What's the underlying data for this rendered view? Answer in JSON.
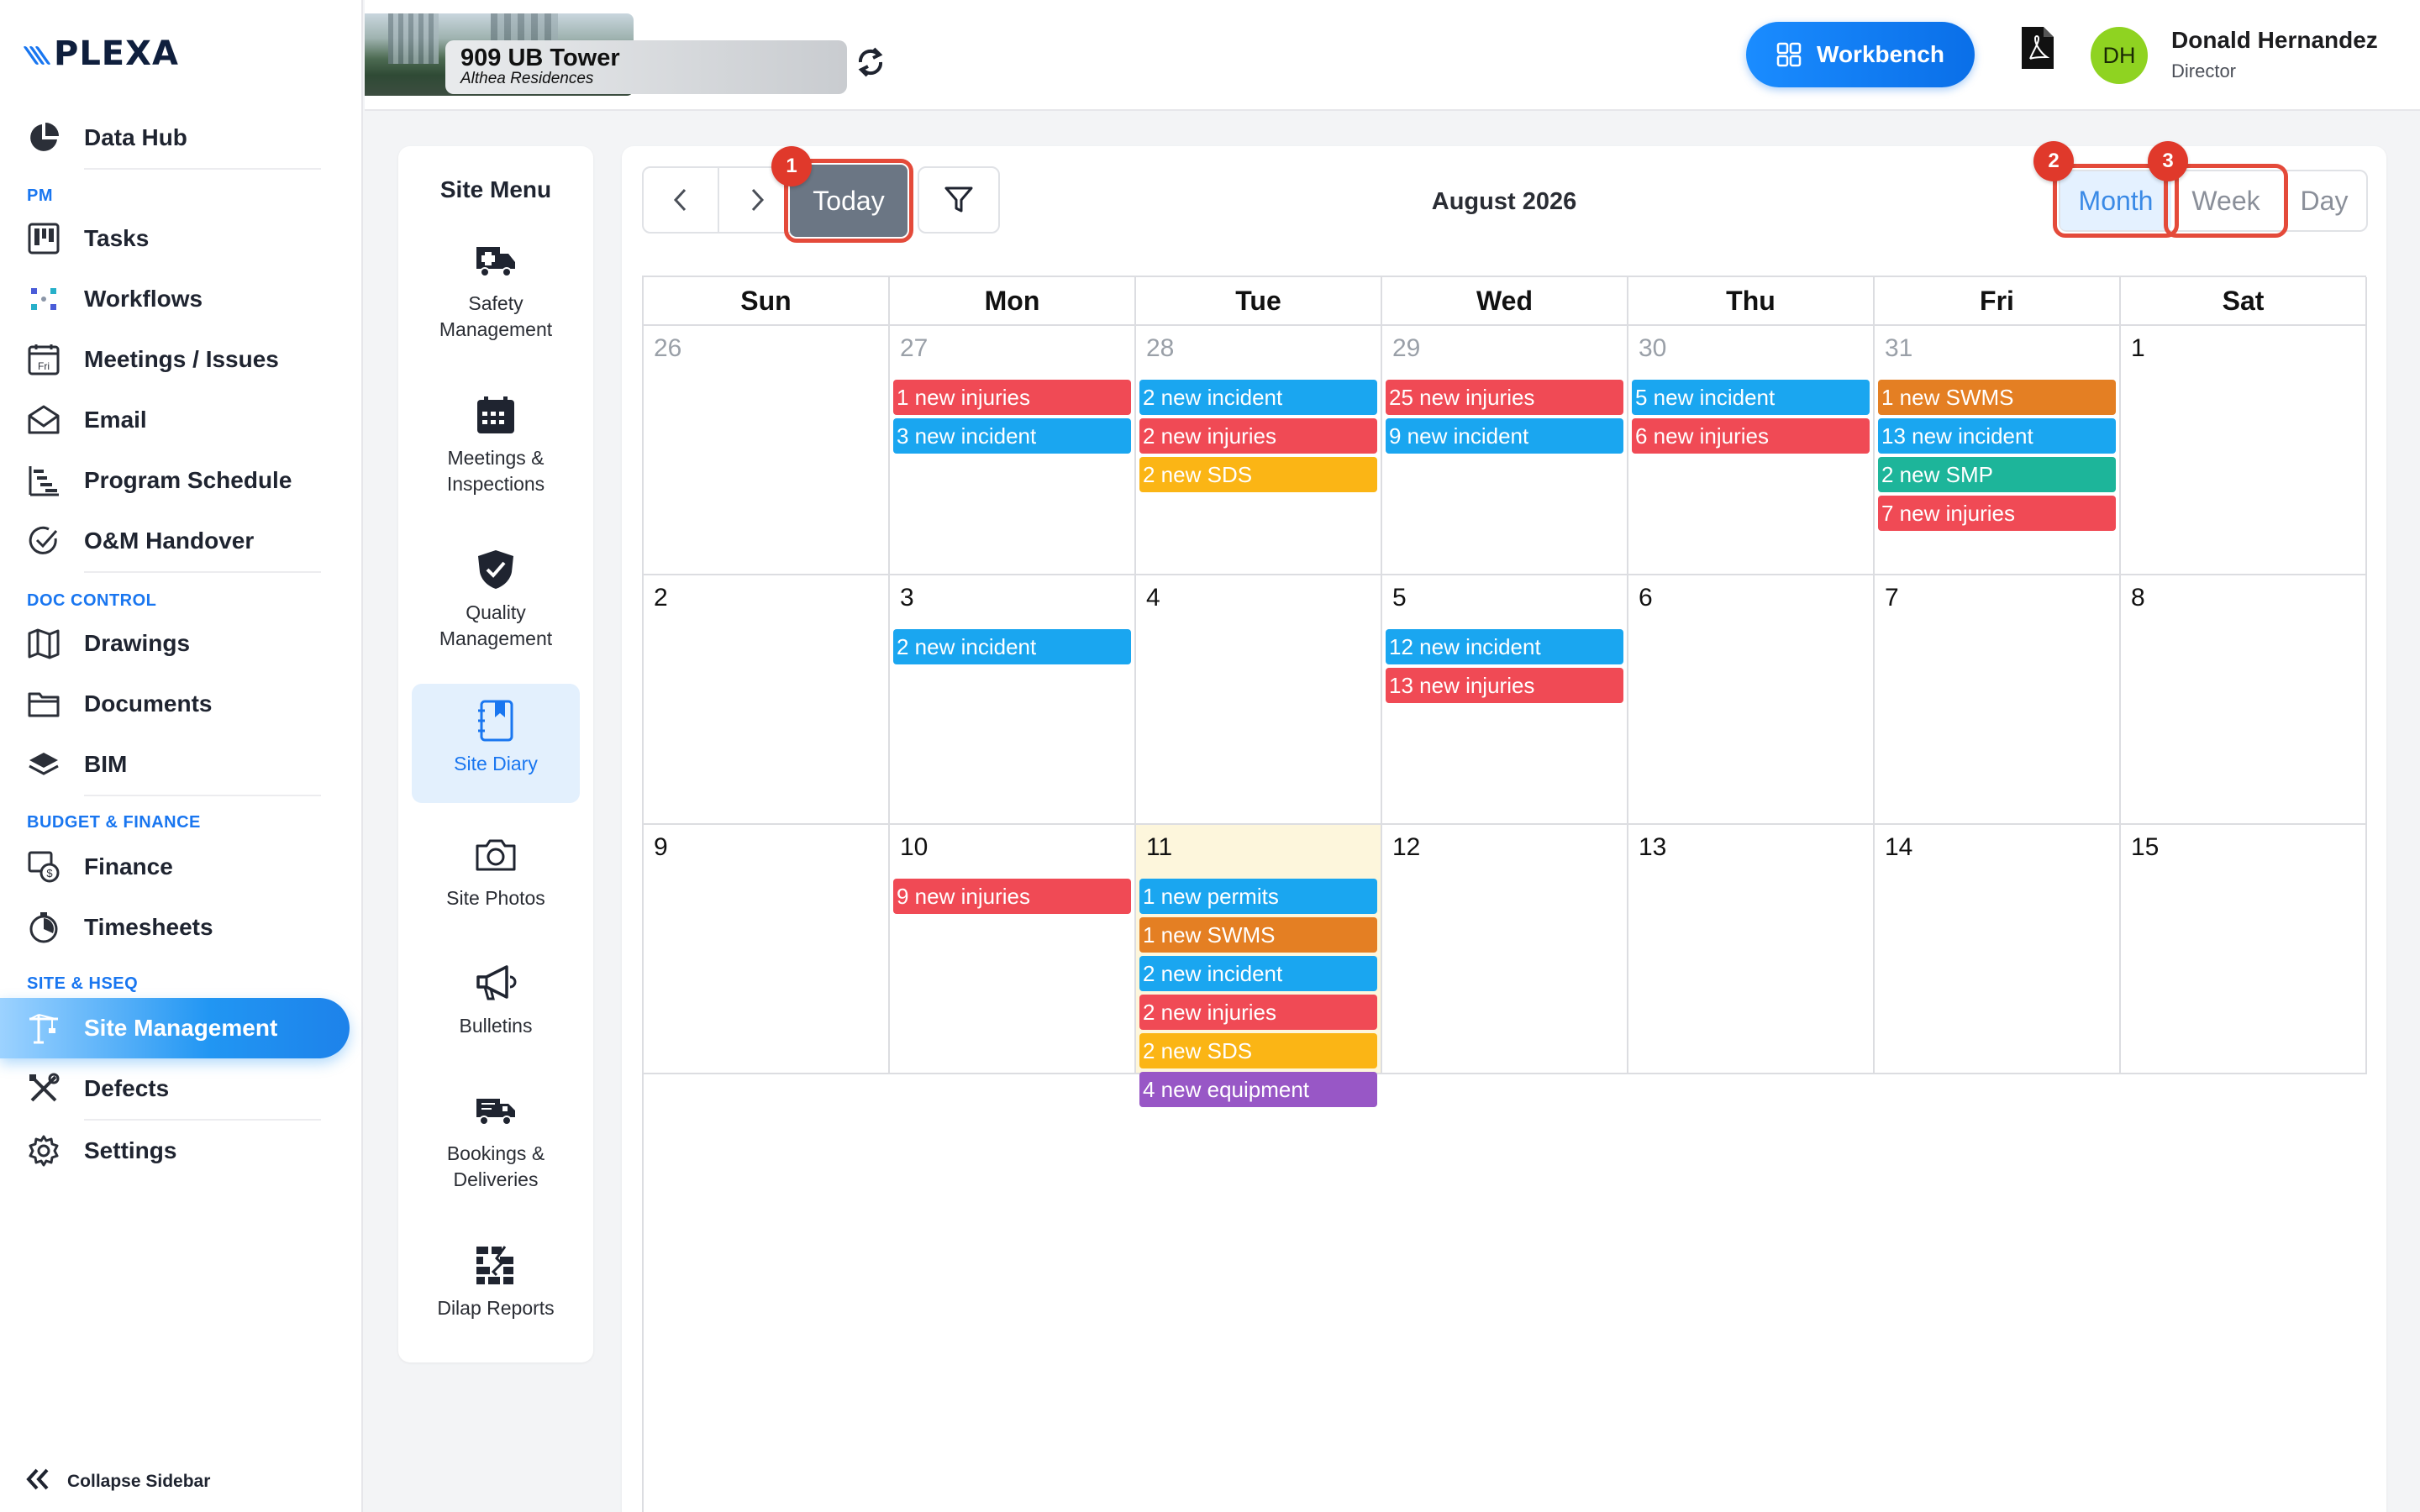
{
  "brand": {
    "name": "PLEXA"
  },
  "sidebar": {
    "items": [
      {
        "label": "Data Hub",
        "icon": "pie-chart-icon"
      },
      {
        "label": "Tasks",
        "icon": "kanban-icon"
      },
      {
        "label": "Workflows",
        "icon": "workflow-icon"
      },
      {
        "label": "Meetings / Issues",
        "icon": "calendar-day-icon"
      },
      {
        "label": "Email",
        "icon": "envelope-icon"
      },
      {
        "label": "Program Schedule",
        "icon": "gantt-icon"
      },
      {
        "label": "O&M Handover",
        "icon": "check-circle-icon"
      },
      {
        "label": "Drawings",
        "icon": "map-icon"
      },
      {
        "label": "Documents",
        "icon": "folder-icon"
      },
      {
        "label": "BIM",
        "icon": "layers-icon"
      },
      {
        "label": "Finance",
        "icon": "finance-icon"
      },
      {
        "label": "Timesheets",
        "icon": "stopwatch-icon"
      },
      {
        "label": "Site Management",
        "icon": "crane-icon"
      },
      {
        "label": "Defects",
        "icon": "tools-icon"
      },
      {
        "label": "Settings",
        "icon": "gear-icon"
      }
    ],
    "sections": {
      "pm": "PM",
      "doc": "DOC CONTROL",
      "budget": "BUDGET & FINANCE",
      "site": "SITE & HSEQ"
    },
    "active": "Site Management",
    "collapse_label": "Collapse Sidebar",
    "calendar_icon_text": "Fri"
  },
  "header": {
    "project_name": "909 UB Tower",
    "project_sub": "Althea Residences",
    "workbench_label": "Workbench",
    "user": {
      "initials": "DH",
      "name": "Donald Hernandez",
      "role": "Director"
    }
  },
  "site_menu": {
    "title": "Site Menu",
    "items": [
      {
        "label1": "Safety",
        "label2": "Management",
        "icon": "ambulance-icon"
      },
      {
        "label1": "Meetings &",
        "label2": "Inspections",
        "icon": "calendar-icon"
      },
      {
        "label1": "Quality",
        "label2": "Management",
        "icon": "shield-check-icon"
      },
      {
        "label1": "Site Diary",
        "label2": "",
        "icon": "diary-icon"
      },
      {
        "label1": "Site Photos",
        "label2": "",
        "icon": "camera-icon"
      },
      {
        "label1": "Bulletins",
        "label2": "",
        "icon": "megaphone-icon"
      },
      {
        "label1": "Bookings &",
        "label2": "Deliveries",
        "icon": "truck-icon"
      },
      {
        "label1": "Dilap Reports",
        "label2": "",
        "icon": "broken-wall-icon"
      }
    ],
    "active": "Site Diary"
  },
  "calendar": {
    "title": "August 2026",
    "today_label": "Today",
    "views": {
      "month": "Month",
      "week": "Week",
      "day": "Day"
    },
    "active_view": "Month",
    "badges": [
      "1",
      "2",
      "3"
    ],
    "weekdays": [
      "Sun",
      "Mon",
      "Tue",
      "Wed",
      "Thu",
      "Fri",
      "Sat"
    ],
    "colors": {
      "injuries": "#f04a55",
      "incident": "#1aa6f0",
      "sds": "#fbb515",
      "swms": "#e47f23",
      "smp": "#1db59a",
      "permits": "#1aa6f0",
      "equipment": "#9857c6"
    },
    "weeks": [
      [
        {
          "day": "26",
          "other": true,
          "events": []
        },
        {
          "day": "27",
          "other": true,
          "events": [
            {
              "text": "1 new injuries",
              "type": "injuries"
            },
            {
              "text": "3 new incident",
              "type": "incident"
            }
          ]
        },
        {
          "day": "28",
          "other": true,
          "events": [
            {
              "text": "2 new incident",
              "type": "incident"
            },
            {
              "text": "2 new injuries",
              "type": "injuries"
            },
            {
              "text": "2 new SDS",
              "type": "sds"
            }
          ]
        },
        {
          "day": "29",
          "other": true,
          "events": [
            {
              "text": "25 new injuries",
              "type": "injuries"
            },
            {
              "text": "9 new incident",
              "type": "incident"
            }
          ]
        },
        {
          "day": "30",
          "other": true,
          "events": [
            {
              "text": "5 new incident",
              "type": "incident"
            },
            {
              "text": "6 new injuries",
              "type": "injuries"
            }
          ]
        },
        {
          "day": "31",
          "other": true,
          "events": [
            {
              "text": "1 new SWMS",
              "type": "swms"
            },
            {
              "text": "13 new incident",
              "type": "incident"
            },
            {
              "text": "2 new SMP",
              "type": "smp"
            },
            {
              "text": "7 new injuries",
              "type": "injuries"
            }
          ]
        },
        {
          "day": "1",
          "other": false,
          "events": []
        }
      ],
      [
        {
          "day": "2",
          "other": false,
          "events": []
        },
        {
          "day": "3",
          "other": false,
          "events": [
            {
              "text": "2 new incident",
              "type": "incident"
            }
          ]
        },
        {
          "day": "4",
          "other": false,
          "events": []
        },
        {
          "day": "5",
          "other": false,
          "events": [
            {
              "text": "12 new incident",
              "type": "incident"
            },
            {
              "text": "13 new injuries",
              "type": "injuries"
            }
          ]
        },
        {
          "day": "6",
          "other": false,
          "events": []
        },
        {
          "day": "7",
          "other": false,
          "events": []
        },
        {
          "day": "8",
          "other": false,
          "events": []
        }
      ],
      [
        {
          "day": "9",
          "other": false,
          "events": []
        },
        {
          "day": "10",
          "other": false,
          "events": [
            {
              "text": "9 new injuries",
              "type": "injuries"
            }
          ]
        },
        {
          "day": "11",
          "other": false,
          "today": true,
          "events": [
            {
              "text": "1 new permits",
              "type": "permits"
            },
            {
              "text": "1 new SWMS",
              "type": "swms"
            },
            {
              "text": "2 new incident",
              "type": "incident"
            },
            {
              "text": "2 new injuries",
              "type": "injuries"
            },
            {
              "text": "2 new SDS",
              "type": "sds"
            },
            {
              "text": "4 new equipment",
              "type": "equipment"
            }
          ]
        },
        {
          "day": "12",
          "other": false,
          "events": []
        },
        {
          "day": "13",
          "other": false,
          "events": []
        },
        {
          "day": "14",
          "other": false,
          "events": []
        },
        {
          "day": "15",
          "other": false,
          "events": []
        }
      ]
    ]
  }
}
